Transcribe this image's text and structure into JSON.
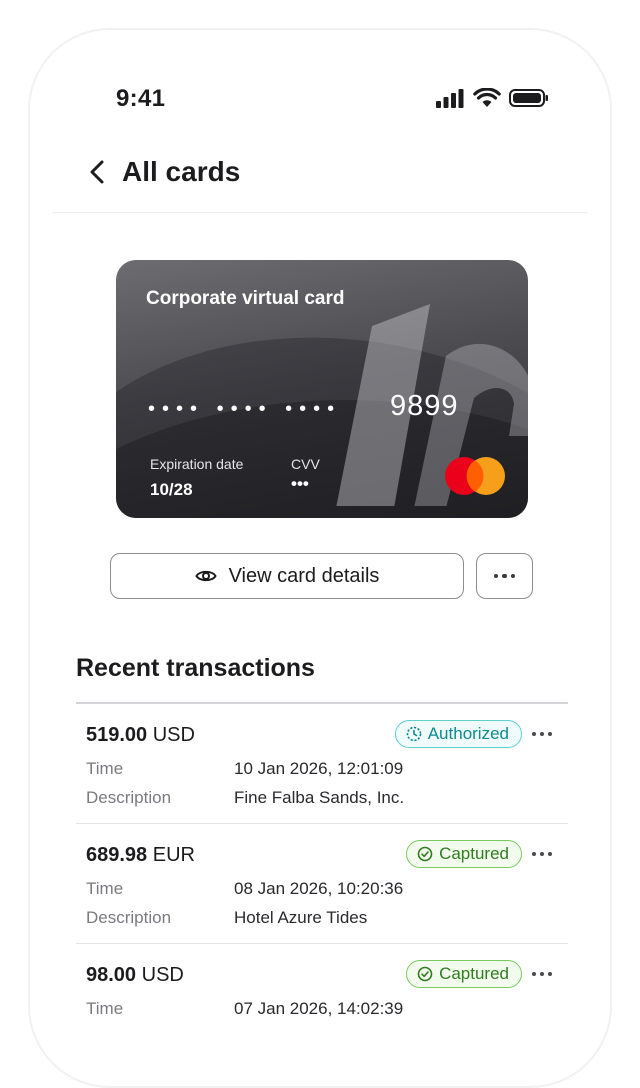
{
  "status_bar": {
    "time": "9:41"
  },
  "header": {
    "title": "All cards"
  },
  "card": {
    "title": "Corporate virtual card",
    "masked_number": "•••• •••• ••••",
    "last4": "9899",
    "expiration_label": "Expiration date",
    "expiration_value": "10/28",
    "cvv_label": "CVV",
    "cvv_value": "•••",
    "network": "mastercard"
  },
  "actions": {
    "view_details_label": "View card details",
    "view_icon": "eye-icon",
    "more_icon": "more-horizontal-icon"
  },
  "transactions": {
    "heading": "Recent transactions",
    "time_label": "Time",
    "description_label": "Description",
    "items": [
      {
        "amount": "519.00",
        "currency": "USD",
        "status": "Authorized",
        "status_icon": "clock-icon",
        "time": "10 Jan 2026, 12:01:09",
        "description": "Fine Falba Sands, Inc."
      },
      {
        "amount": "689.98",
        "currency": "EUR",
        "status": "Captured",
        "status_icon": "check-circle-icon",
        "time": "08 Jan 2026, 10:20:36",
        "description": "Hotel Azure Tides"
      },
      {
        "amount": "98.00",
        "currency": "USD",
        "status": "Captured",
        "status_icon": "check-circle-icon",
        "time": "07 Jan 2026, 14:02:39",
        "description": ""
      }
    ]
  },
  "colors": {
    "authorized": "#0d8a90",
    "captured": "#2f7d1f",
    "mastercard_red": "#eb001b",
    "mastercard_orange": "#f79e1b"
  }
}
